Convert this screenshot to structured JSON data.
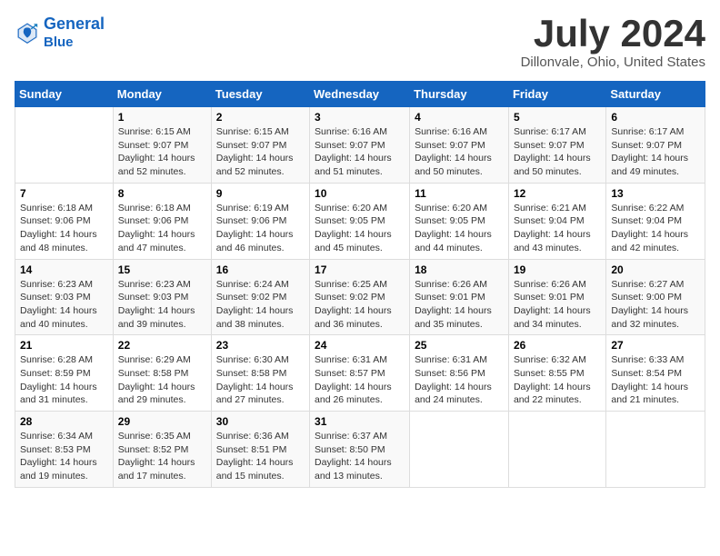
{
  "header": {
    "logo_line1": "General",
    "logo_line2": "Blue",
    "month_year": "July 2024",
    "location": "Dillonvale, Ohio, United States"
  },
  "days_of_week": [
    "Sunday",
    "Monday",
    "Tuesday",
    "Wednesday",
    "Thursday",
    "Friday",
    "Saturday"
  ],
  "weeks": [
    [
      {
        "day": "",
        "sunrise": "",
        "sunset": "",
        "daylight": ""
      },
      {
        "day": "1",
        "sunrise": "Sunrise: 6:15 AM",
        "sunset": "Sunset: 9:07 PM",
        "daylight": "Daylight: 14 hours and 52 minutes."
      },
      {
        "day": "2",
        "sunrise": "Sunrise: 6:15 AM",
        "sunset": "Sunset: 9:07 PM",
        "daylight": "Daylight: 14 hours and 52 minutes."
      },
      {
        "day": "3",
        "sunrise": "Sunrise: 6:16 AM",
        "sunset": "Sunset: 9:07 PM",
        "daylight": "Daylight: 14 hours and 51 minutes."
      },
      {
        "day": "4",
        "sunrise": "Sunrise: 6:16 AM",
        "sunset": "Sunset: 9:07 PM",
        "daylight": "Daylight: 14 hours and 50 minutes."
      },
      {
        "day": "5",
        "sunrise": "Sunrise: 6:17 AM",
        "sunset": "Sunset: 9:07 PM",
        "daylight": "Daylight: 14 hours and 50 minutes."
      },
      {
        "day": "6",
        "sunrise": "Sunrise: 6:17 AM",
        "sunset": "Sunset: 9:07 PM",
        "daylight": "Daylight: 14 hours and 49 minutes."
      }
    ],
    [
      {
        "day": "7",
        "sunrise": "Sunrise: 6:18 AM",
        "sunset": "Sunset: 9:06 PM",
        "daylight": "Daylight: 14 hours and 48 minutes."
      },
      {
        "day": "8",
        "sunrise": "Sunrise: 6:18 AM",
        "sunset": "Sunset: 9:06 PM",
        "daylight": "Daylight: 14 hours and 47 minutes."
      },
      {
        "day": "9",
        "sunrise": "Sunrise: 6:19 AM",
        "sunset": "Sunset: 9:06 PM",
        "daylight": "Daylight: 14 hours and 46 minutes."
      },
      {
        "day": "10",
        "sunrise": "Sunrise: 6:20 AM",
        "sunset": "Sunset: 9:05 PM",
        "daylight": "Daylight: 14 hours and 45 minutes."
      },
      {
        "day": "11",
        "sunrise": "Sunrise: 6:20 AM",
        "sunset": "Sunset: 9:05 PM",
        "daylight": "Daylight: 14 hours and 44 minutes."
      },
      {
        "day": "12",
        "sunrise": "Sunrise: 6:21 AM",
        "sunset": "Sunset: 9:04 PM",
        "daylight": "Daylight: 14 hours and 43 minutes."
      },
      {
        "day": "13",
        "sunrise": "Sunrise: 6:22 AM",
        "sunset": "Sunset: 9:04 PM",
        "daylight": "Daylight: 14 hours and 42 minutes."
      }
    ],
    [
      {
        "day": "14",
        "sunrise": "Sunrise: 6:23 AM",
        "sunset": "Sunset: 9:03 PM",
        "daylight": "Daylight: 14 hours and 40 minutes."
      },
      {
        "day": "15",
        "sunrise": "Sunrise: 6:23 AM",
        "sunset": "Sunset: 9:03 PM",
        "daylight": "Daylight: 14 hours and 39 minutes."
      },
      {
        "day": "16",
        "sunrise": "Sunrise: 6:24 AM",
        "sunset": "Sunset: 9:02 PM",
        "daylight": "Daylight: 14 hours and 38 minutes."
      },
      {
        "day": "17",
        "sunrise": "Sunrise: 6:25 AM",
        "sunset": "Sunset: 9:02 PM",
        "daylight": "Daylight: 14 hours and 36 minutes."
      },
      {
        "day": "18",
        "sunrise": "Sunrise: 6:26 AM",
        "sunset": "Sunset: 9:01 PM",
        "daylight": "Daylight: 14 hours and 35 minutes."
      },
      {
        "day": "19",
        "sunrise": "Sunrise: 6:26 AM",
        "sunset": "Sunset: 9:01 PM",
        "daylight": "Daylight: 14 hours and 34 minutes."
      },
      {
        "day": "20",
        "sunrise": "Sunrise: 6:27 AM",
        "sunset": "Sunset: 9:00 PM",
        "daylight": "Daylight: 14 hours and 32 minutes."
      }
    ],
    [
      {
        "day": "21",
        "sunrise": "Sunrise: 6:28 AM",
        "sunset": "Sunset: 8:59 PM",
        "daylight": "Daylight: 14 hours and 31 minutes."
      },
      {
        "day": "22",
        "sunrise": "Sunrise: 6:29 AM",
        "sunset": "Sunset: 8:58 PM",
        "daylight": "Daylight: 14 hours and 29 minutes."
      },
      {
        "day": "23",
        "sunrise": "Sunrise: 6:30 AM",
        "sunset": "Sunset: 8:58 PM",
        "daylight": "Daylight: 14 hours and 27 minutes."
      },
      {
        "day": "24",
        "sunrise": "Sunrise: 6:31 AM",
        "sunset": "Sunset: 8:57 PM",
        "daylight": "Daylight: 14 hours and 26 minutes."
      },
      {
        "day": "25",
        "sunrise": "Sunrise: 6:31 AM",
        "sunset": "Sunset: 8:56 PM",
        "daylight": "Daylight: 14 hours and 24 minutes."
      },
      {
        "day": "26",
        "sunrise": "Sunrise: 6:32 AM",
        "sunset": "Sunset: 8:55 PM",
        "daylight": "Daylight: 14 hours and 22 minutes."
      },
      {
        "day": "27",
        "sunrise": "Sunrise: 6:33 AM",
        "sunset": "Sunset: 8:54 PM",
        "daylight": "Daylight: 14 hours and 21 minutes."
      }
    ],
    [
      {
        "day": "28",
        "sunrise": "Sunrise: 6:34 AM",
        "sunset": "Sunset: 8:53 PM",
        "daylight": "Daylight: 14 hours and 19 minutes."
      },
      {
        "day": "29",
        "sunrise": "Sunrise: 6:35 AM",
        "sunset": "Sunset: 8:52 PM",
        "daylight": "Daylight: 14 hours and 17 minutes."
      },
      {
        "day": "30",
        "sunrise": "Sunrise: 6:36 AM",
        "sunset": "Sunset: 8:51 PM",
        "daylight": "Daylight: 14 hours and 15 minutes."
      },
      {
        "day": "31",
        "sunrise": "Sunrise: 6:37 AM",
        "sunset": "Sunset: 8:50 PM",
        "daylight": "Daylight: 14 hours and 13 minutes."
      },
      {
        "day": "",
        "sunrise": "",
        "sunset": "",
        "daylight": ""
      },
      {
        "day": "",
        "sunrise": "",
        "sunset": "",
        "daylight": ""
      },
      {
        "day": "",
        "sunrise": "",
        "sunset": "",
        "daylight": ""
      }
    ]
  ]
}
